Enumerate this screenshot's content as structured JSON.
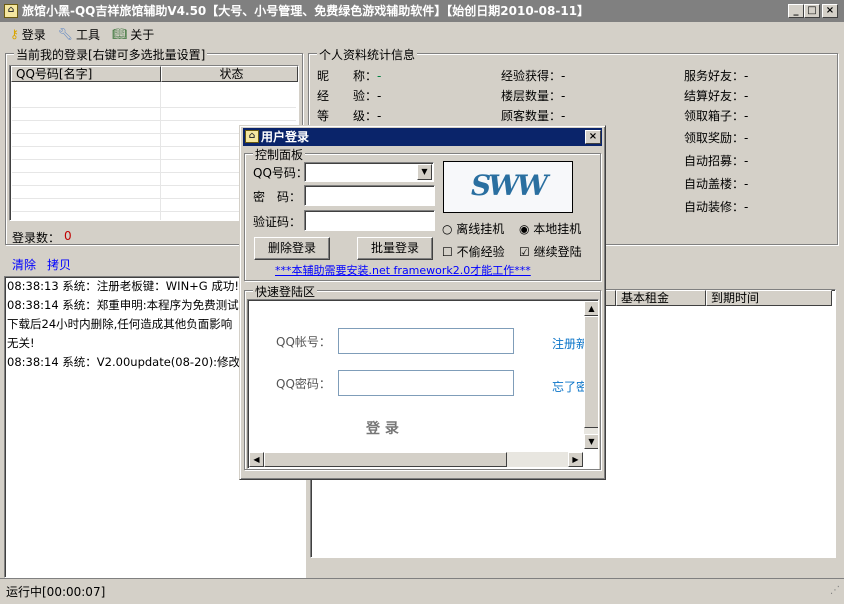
{
  "window": {
    "title": "旅馆小黑-QQ吉祥旅馆辅助V4.50【大号、小号管理、免费绿色游戏辅助软件】【始创日期2010-08-11】"
  },
  "menu": [
    {
      "label": "登录",
      "icon": "key-icon"
    },
    {
      "label": "工具",
      "icon": "wrench-icon"
    },
    {
      "label": "关于",
      "icon": "book-icon"
    }
  ],
  "logins": {
    "legend": "当前我的登录[右键可多选批量设置]",
    "columns": [
      "QQ号码[名字]",
      "状态"
    ],
    "count_label": "登录数：",
    "count": "0"
  },
  "actions": {
    "clear": "清除",
    "copy": "拷贝"
  },
  "log": [
    "08:38:13 系统：注册老板键：WIN+G 成功!",
    "08:38:14 系统：郑重申明:本程序为免费测试",
    "下载后24小时内删除,任何造成其他负面影响",
    "无关!",
    "08:38:14 系统：V2.00update(08-20):修改b"
  ],
  "profile": {
    "legend": "个人资料统计信息",
    "fields": [
      {
        "label": "昵　　称：",
        "value": "-"
      },
      {
        "label": "经　　验：",
        "value": "-"
      },
      {
        "label": "等　　级：",
        "value": "-"
      },
      {
        "label": "经验获得：",
        "value": "-"
      },
      {
        "label": "楼层数量：",
        "value": "-"
      },
      {
        "label": "顾客数量：",
        "value": "-"
      },
      {
        "label": "服务好友：",
        "value": "-"
      },
      {
        "label": "结算好友：",
        "value": "-"
      },
      {
        "label": "领取箱子：",
        "value": "-"
      },
      {
        "label": "领取奖励：",
        "value": "-"
      },
      {
        "label": "自动招募：",
        "value": "-"
      },
      {
        "label": "自动盖楼：",
        "value": "-"
      },
      {
        "label": "自动装修：",
        "value": "-"
      }
    ]
  },
  "table": {
    "columns": [
      "基本租金",
      "到期时间"
    ]
  },
  "status": {
    "text": "运行中[00:00:07]"
  },
  "dialog": {
    "title": "用户登录",
    "panel_legend": "控制面板",
    "qq_label": "QQ号码：",
    "pwd_label": "密　码：",
    "code_label": "验证码：",
    "qq_value": "",
    "captcha_text": "SWW",
    "delete_btn": "删除登录",
    "batch_btn": "批量登录",
    "radio_offline": "离线挂机",
    "radio_local": "本地挂机",
    "selected_mode": "本地挂机",
    "chk_no_exp": "不偷经验",
    "chk_continue": "继续登陆",
    "no_exp_checked": false,
    "continue_checked": true,
    "notice": "***本辅助需要安装.net framework2.0才能工作***",
    "quick_legend": "快速登陆区",
    "quick_qq_label": "QQ帐号：",
    "quick_pwd_label": "QQ密码：",
    "register_link": "注册新",
    "forgot_link": "忘了密",
    "login_btn": "登 录"
  }
}
